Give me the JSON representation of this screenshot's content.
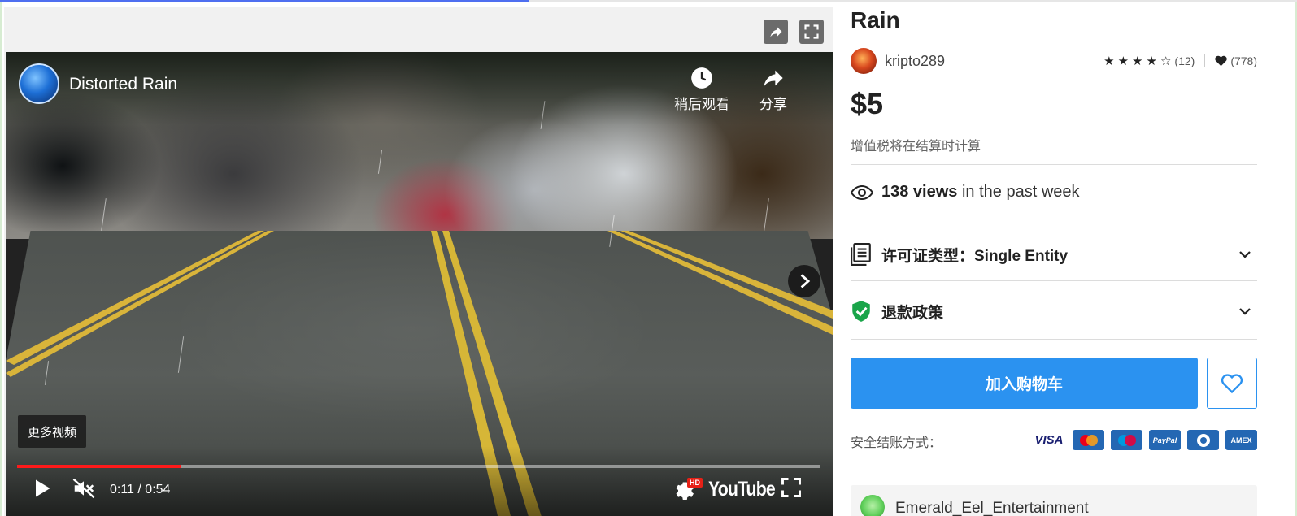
{
  "media": {
    "toolbar": {
      "share_icon": "share-arrow-icon",
      "fullscreen_icon": "expand-icon"
    }
  },
  "player": {
    "channel_avatar_icon": "channel-avatar",
    "title": "Distorted Rain",
    "watch_later_label": "稍后观看",
    "share_label": "分享",
    "more_videos_label": "更多视频",
    "time": "0:11 / 0:54",
    "progress_fraction": 0.204,
    "hd_badge": "HD",
    "logo_text": "YouTube",
    "colors": {
      "progress": "#ff1a1a",
      "hd_badge": "#e62117"
    }
  },
  "product": {
    "title": "Rain",
    "seller": "kripto289",
    "rating_stars": 4,
    "rating_count": "(12)",
    "favorites": "(778)",
    "price": "$5",
    "tax_note": "增值税将在结算时计算",
    "views_count": "138 views",
    "views_suffix": "in the past week",
    "license_label": "许可证类型：Single Entity",
    "refund_label": "退款政策",
    "add_to_cart_label": "加入购物车",
    "payment_label": "安全结账方式：",
    "payment_methods": [
      "VISA",
      "Mastercard",
      "Maestro",
      "PayPal",
      "Diners",
      "AMEX"
    ],
    "publisher": "Emerald_Eel_Entertainment",
    "colors": {
      "accent": "#2b92f0",
      "shield": "#1aa54a"
    }
  }
}
